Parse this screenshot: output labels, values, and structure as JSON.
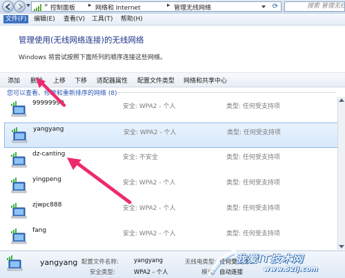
{
  "window": {
    "breadcrumbs": [
      "控制面板",
      "网络和 Internet",
      "管理无线网络"
    ],
    "search_placeholder": "搜索 管理无线网络"
  },
  "menu": [
    "文件(F)",
    "编辑(E)",
    "查看(V)",
    "工具(T)",
    "帮助(H)"
  ],
  "page": {
    "title": "管理使用(无线网络连接)的无线网络",
    "subtitle": "Windows 将尝试按照下面所列的顺序连接这些网络。"
  },
  "toolbar": [
    "添加",
    "删除",
    "上移",
    "下移",
    "适配器属性",
    "配置文件类型",
    "网络和共享中心"
  ],
  "group_header": "您可以查看、修改和重新排序的网络 (8)",
  "networks": [
    {
      "name": "99999999",
      "security": "安全: WPA2 - 个人",
      "type": "类型: 任何受支持项",
      "selected": false
    },
    {
      "name": "yangyang",
      "security": "安全: WPA2 - 个人",
      "type": "类型: 任何受支持项",
      "selected": true
    },
    {
      "name": "dz-canting",
      "security": "安全: 不安全",
      "type": "类型: 任何受支持项",
      "selected": false
    },
    {
      "name": "yingpeng",
      "security": "安全: WPA2 - 个人",
      "type": "类型: 任何受支持项",
      "selected": false
    },
    {
      "name": "zjwpc888",
      "security": "安全: WPA2 - 个人",
      "type": "类型: 任何受支持项",
      "selected": false
    },
    {
      "name": "fang",
      "security": "安全: WPA2 - 个人",
      "type": "类型: 任何受支持项",
      "selected": false
    }
  ],
  "details": {
    "name": "yangyang",
    "profile_label": "配置文件名称:",
    "profile_value": "yangyang",
    "security_label": "安全类型:",
    "security_value": "WPA2 - 个人",
    "radio_label": "无线电类型:",
    "radio_value": "任何受支持项",
    "mode_label": "模式:",
    "mode_value": "自动连接"
  },
  "watermark": {
    "text": "我爱IT技术网",
    "url": "www.52ij.com"
  },
  "colors": {
    "accent": "#3a6fc0",
    "title": "#1e3287",
    "link": "#2a56b5",
    "arrow": "#ee2a6e"
  }
}
